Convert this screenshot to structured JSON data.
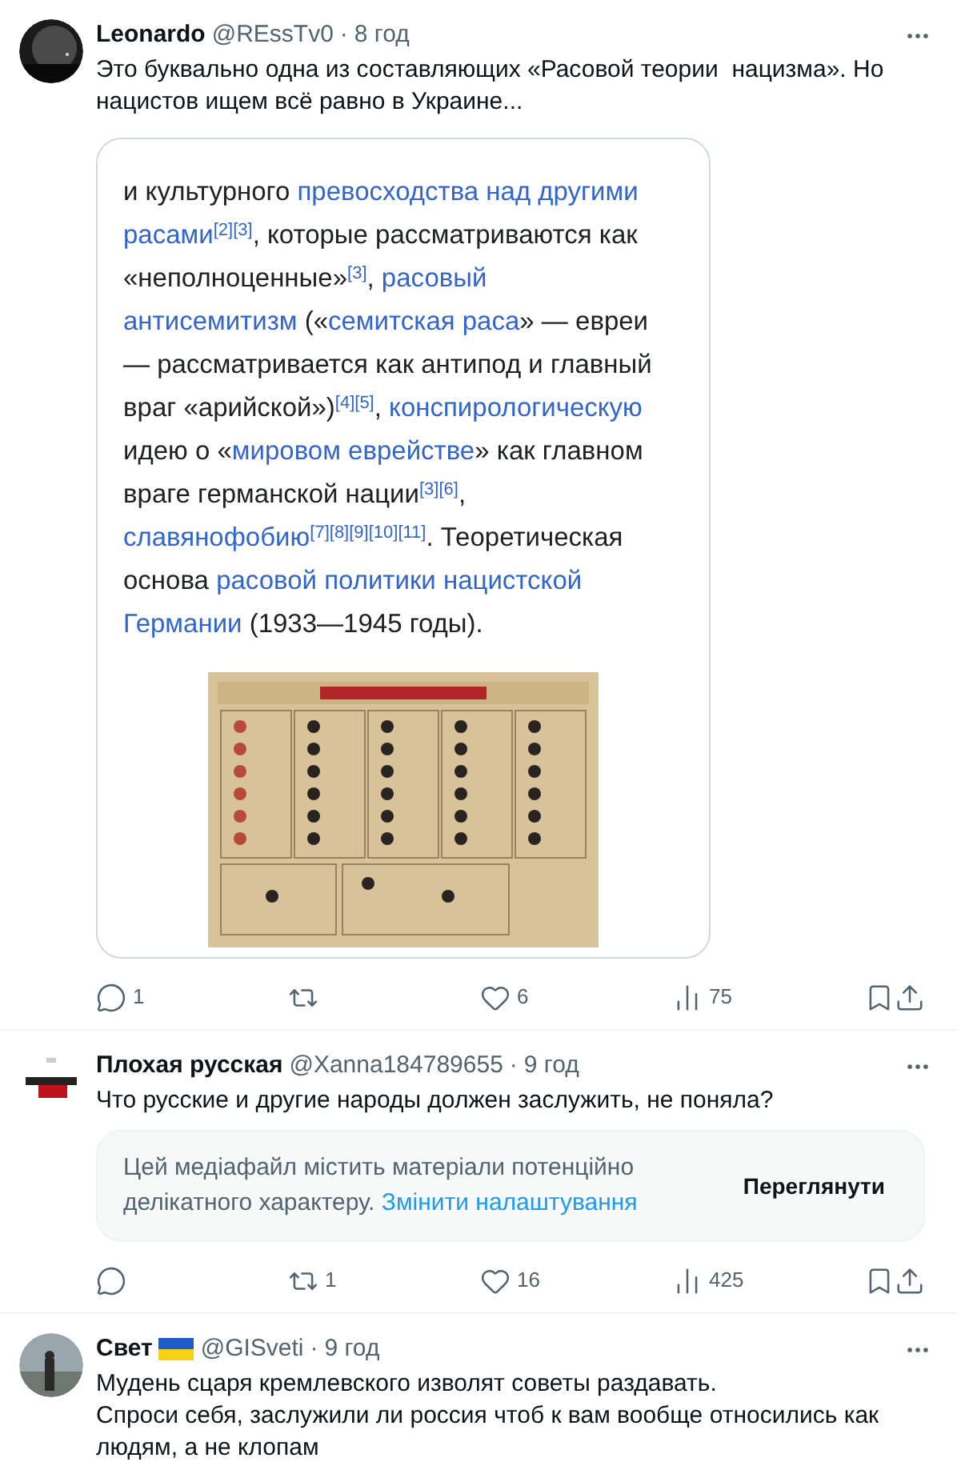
{
  "tweets": [
    {
      "name": "Leonardo",
      "flag": false,
      "handle": "@REssTv0",
      "separator": "·",
      "time": "8 год",
      "text": [
        "Это буквально одна из составляющих «Расовой теории  нацизма». Но",
        "нацистов ищем всё равно в Украине..."
      ],
      "embed": {
        "lines": [
          [
            {
              "kind": "text",
              "text": "и культурного "
            },
            {
              "kind": "link",
              "text": "превосходства над другими"
            }
          ],
          [
            {
              "kind": "link",
              "text": "расами"
            },
            {
              "kind": "ref",
              "text": "[2][3]"
            },
            {
              "kind": "text",
              "text": ", которые рассматриваются как"
            }
          ],
          [
            {
              "kind": "text",
              "text": "«неполноценные»"
            },
            {
              "kind": "ref",
              "text": "[3]"
            },
            {
              "kind": "text",
              "text": ", "
            },
            {
              "kind": "link",
              "text": "расовый"
            }
          ],
          [
            {
              "kind": "link",
              "text": "антисемитизм"
            },
            {
              "kind": "text",
              "text": " («"
            },
            {
              "kind": "link",
              "text": "семитская раса"
            },
            {
              "kind": "text",
              "text": "» — евреи"
            }
          ],
          [
            {
              "kind": "text",
              "text": "— рассматривается как антипод и главный"
            }
          ],
          [
            {
              "kind": "text",
              "text": "враг «арийской»)"
            },
            {
              "kind": "ref",
              "text": "[4][5]"
            },
            {
              "kind": "text",
              "text": ", "
            },
            {
              "kind": "link",
              "text": "конспирологическую"
            }
          ],
          [
            {
              "kind": "text",
              "text": "идею о «"
            },
            {
              "kind": "link",
              "text": "мировом еврействе"
            },
            {
              "kind": "text",
              "text": "» как главном"
            }
          ],
          [
            {
              "kind": "text",
              "text": "враге германской нации"
            },
            {
              "kind": "ref",
              "text": "[3][6]"
            },
            {
              "kind": "text",
              "text": ","
            }
          ],
          [
            {
              "kind": "link",
              "text": "славянофобию"
            },
            {
              "kind": "ref",
              "text": "[7][8][9][10][11]"
            },
            {
              "kind": "text",
              "text": ". Теоретическая"
            }
          ],
          [
            {
              "kind": "text",
              "text": "основа "
            },
            {
              "kind": "link",
              "text": "расовой политики нацистской"
            }
          ],
          [
            {
              "kind": "link",
              "text": "Германии"
            },
            {
              "kind": "text",
              "text": " (1933—1945 годы)."
            }
          ]
        ]
      },
      "actions": [
        {
          "kind": "reply",
          "count": "1"
        },
        {
          "kind": "retweet"
        },
        {
          "kind": "like",
          "count": "6"
        },
        {
          "kind": "views",
          "count": "75"
        },
        {
          "kind": "bookmark"
        },
        {
          "kind": "share"
        }
      ]
    },
    {
      "name": "Плохая русская",
      "flag": false,
      "handle": "@Xanna184789655",
      "separator": "·",
      "time": "9 год",
      "text": [
        "Что русские и другие народы должен заслужить, не поняла?"
      ],
      "sensitive": {
        "message": "Цей медіафайл містить матеріали потенційно делікатного характеру.",
        "link": "Змінити налаштування",
        "button": "Переглянути"
      },
      "actions": [
        {
          "kind": "reply"
        },
        {
          "kind": "retweet",
          "count": "1"
        },
        {
          "kind": "like",
          "count": "16"
        },
        {
          "kind": "views",
          "count": "425"
        },
        {
          "kind": "bookmark"
        },
        {
          "kind": "share"
        }
      ]
    },
    {
      "name": "Свет",
      "flag": true,
      "handle": "@GISveti",
      "separator": "·",
      "time": "9 год",
      "text": [
        "Мудень сцаря кремлевского изволят советы раздавать.",
        "Спроси себя, заслужили ли россия чтоб к вам вообще относились как",
        "людям, а не клопам"
      ]
    }
  ]
}
